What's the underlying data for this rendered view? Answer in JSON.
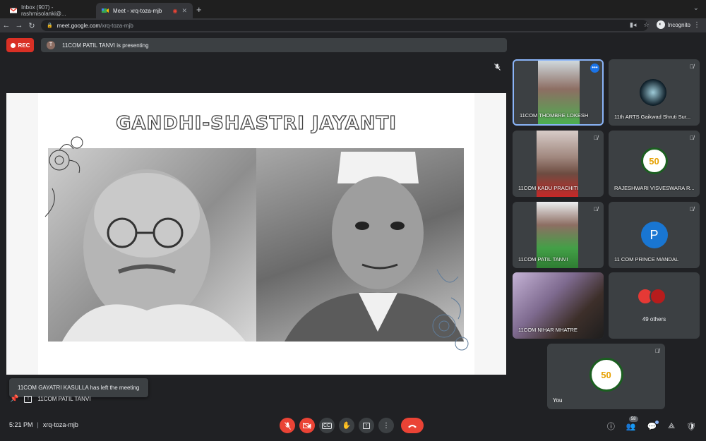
{
  "browser": {
    "tabs": [
      {
        "title": "Inbox (907) - rashmisolanki@...",
        "active": false
      },
      {
        "title": "Meet - xrq-toza-mjb",
        "active": true
      }
    ],
    "url_host": "meet.google.com",
    "url_path": "/xrq-toza-mjb",
    "incognito_label": "Incognito"
  },
  "meeting": {
    "rec_label": "REC",
    "presenter_initial": "T",
    "presenting_text": "11COM PATIL TANVI is presenting",
    "time": "5:21 PM",
    "code": "xrq-toza-mjb",
    "participant_count": "58"
  },
  "slide": {
    "title": "GANDHI-SHASTRI JAYANTI"
  },
  "tiles": [
    {
      "name": "11COM THOMBRE LOKESH"
    },
    {
      "name": "11th ARTS Gaikwad Shruti Sur..."
    },
    {
      "name": "11COM KADU PRACHITI"
    },
    {
      "name": "RAJESHWARI VISVESWARA R..."
    },
    {
      "name": "11COM PATIL TANVI"
    },
    {
      "name": "11 COM PRINCE MANDAL",
      "initial": "P"
    },
    {
      "name": "11COM NIHAR MHATRE"
    },
    {
      "name": "49 others"
    },
    {
      "name": "You"
    }
  ],
  "logo_text": "50",
  "toast": "11COM GAYATRI KASULLA has left the meeting",
  "presenter_bar_name": "11COM PATIL TANVI",
  "colors": {
    "accent": "#8ab4f8",
    "danger": "#ea4335",
    "surface": "#3c4043",
    "background": "#202124"
  }
}
